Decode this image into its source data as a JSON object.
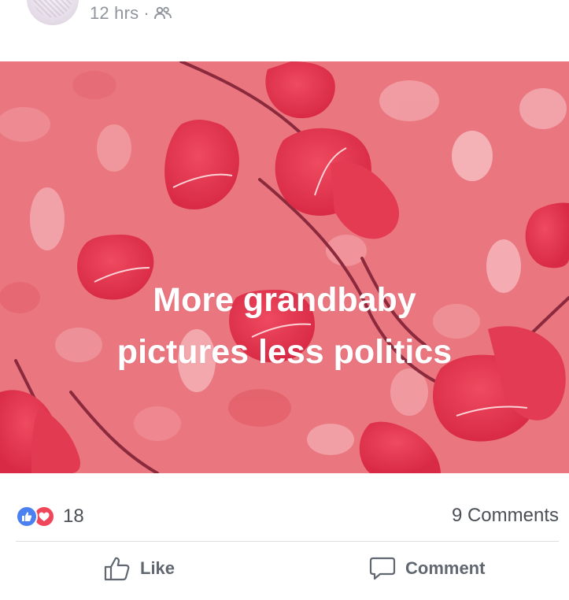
{
  "post": {
    "timestamp": "12 hrs",
    "separator": "·",
    "audience_icon": "friends-icon",
    "image_text_line1": "More grandbaby",
    "image_text_line2": "pictures less politics",
    "background_color": "#e9777e"
  },
  "stats": {
    "reaction_icons": [
      "like-reaction-icon",
      "love-reaction-icon"
    ],
    "reaction_count": "18",
    "comments_count": "9 Comments"
  },
  "actions": {
    "like_label": "Like",
    "comment_label": "Comment"
  },
  "colors": {
    "like_blue": "#4a80f0",
    "love_red": "#f0465a",
    "meta_gray": "#90949c",
    "text_gray": "#4b4f56",
    "action_gray": "#606770"
  }
}
